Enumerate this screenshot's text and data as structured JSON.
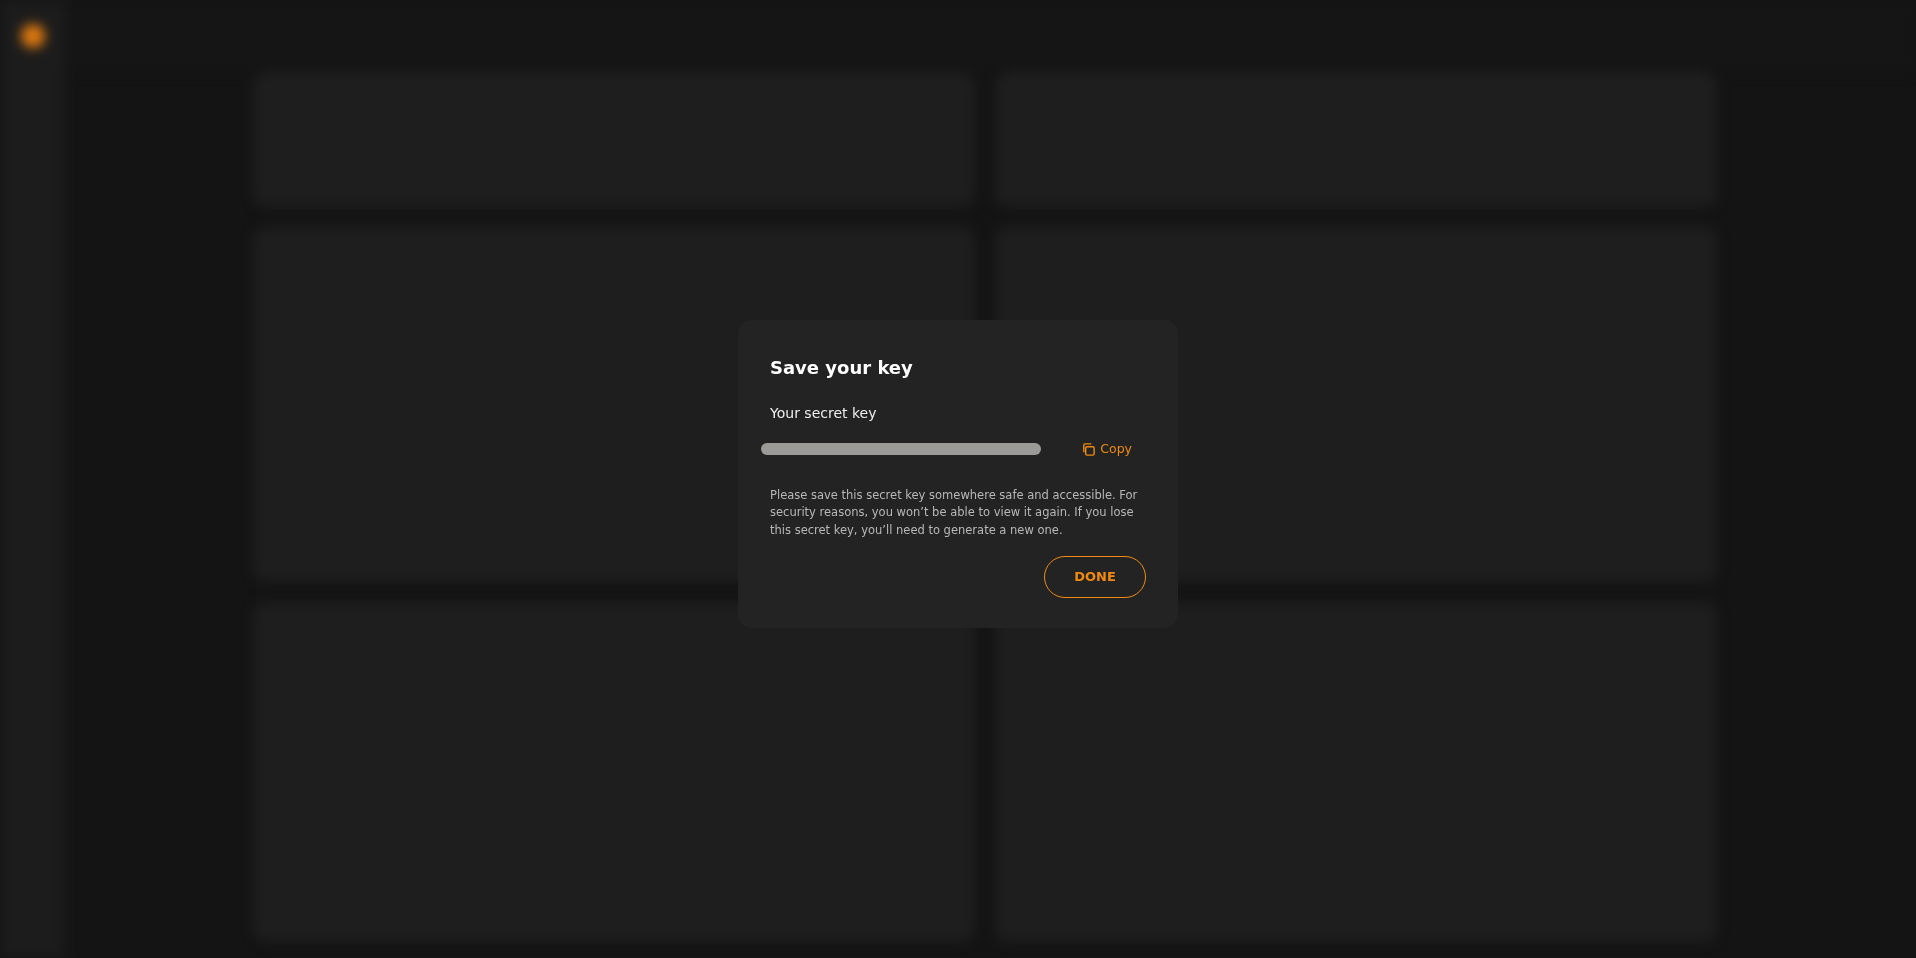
{
  "dialog": {
    "title": "Save your key",
    "field_label": "Your secret key",
    "copy_label": "Copy",
    "message": "Please save this secret key somewhere safe and accessible. For security reasons, you won’t be able to view it again. If you lose this secret key, you’ll need to generate a new one.",
    "button": "DONE"
  }
}
